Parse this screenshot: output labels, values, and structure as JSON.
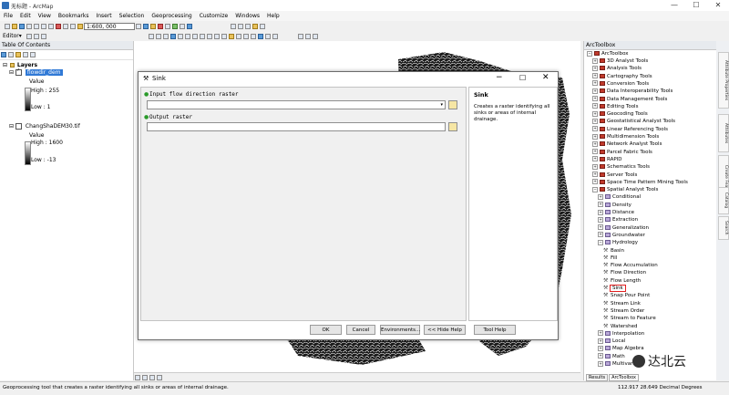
{
  "window": {
    "title": "无标题 - ArcMap",
    "minimize": "—",
    "maximize": "☐",
    "close": "✕"
  },
  "menu": [
    "File",
    "Edit",
    "View",
    "Bookmarks",
    "Insert",
    "Selection",
    "Geoprocessing",
    "Customize",
    "Windows",
    "Help"
  ],
  "toolbar": {
    "scale": "1:600, 000",
    "editor_label": "Editor▾"
  },
  "toc": {
    "title": "Table Of Contents",
    "layers_label": "Layers",
    "layer1": {
      "name": "flowdir_dem",
      "value_label": "Value",
      "high": "High : 255",
      "low": "Low : 1"
    },
    "layer2": {
      "name": "ChangShaDEM30.tif",
      "value_label": "Value",
      "high": "High : 1600",
      "low": "Low : -13"
    }
  },
  "dialog": {
    "title": "Sink",
    "input_label": "Input flow direction raster",
    "output_label": "Output raster",
    "buttons": {
      "ok": "OK",
      "cancel": "Cancel",
      "env": "Environments...",
      "hide": "<< Hide Help",
      "toolhelp": "Tool Help"
    },
    "help_title": "Sink",
    "help_text": "Creates a raster identifying all sinks or areas of internal drainage."
  },
  "arctoolbox": {
    "title": "ArcToolbox",
    "root": "ArcToolbox",
    "toolboxes": [
      "3D Analyst Tools",
      "Analysis Tools",
      "Cartography Tools",
      "Conversion Tools",
      "Data Interoperability Tools",
      "Data Management Tools",
      "Editing Tools",
      "Geocoding Tools",
      "Geostatistical Analyst Tools",
      "Linear Referencing Tools",
      "Multidimension Tools",
      "Network Analyst Tools",
      "Parcel Fabric Tools",
      "RAPID",
      "Schematics Tools",
      "Server Tools",
      "Space Time Pattern Mining Tools",
      "Spatial Analyst Tools"
    ],
    "spatial_children": [
      "Conditional",
      "Density",
      "Distance",
      "Extraction",
      "Generalization",
      "Groundwater",
      "Hydrology"
    ],
    "hydrology_tools": [
      "Basin",
      "Fill",
      "Flow Accumulation",
      "Flow Direction",
      "Flow Length",
      "Sink",
      "Snap Pour Point",
      "Stream Link",
      "Stream Order",
      "Stream to Feature",
      "Watershed"
    ],
    "after": [
      "Interpolation",
      "Local",
      "Map Algebra",
      "Math",
      "Multivariate",
      "Neighborhood"
    ],
    "tabs": {
      "results": "Results",
      "arctoolbox": "ArcToolbox"
    }
  },
  "side_tabs": [
    "Attribute Properties",
    "Attributes",
    "Create Features",
    "Catalog",
    "Search"
  ],
  "status": {
    "message": "Geoprocessing tool that creates a raster identifying all sinks or areas of internal drainage.",
    "coords": "112.917  28.649 Decimal Degrees"
  },
  "watermark": "达北云",
  "colors": {
    "highlight": "#e02020",
    "selection": "#3079d6"
  }
}
